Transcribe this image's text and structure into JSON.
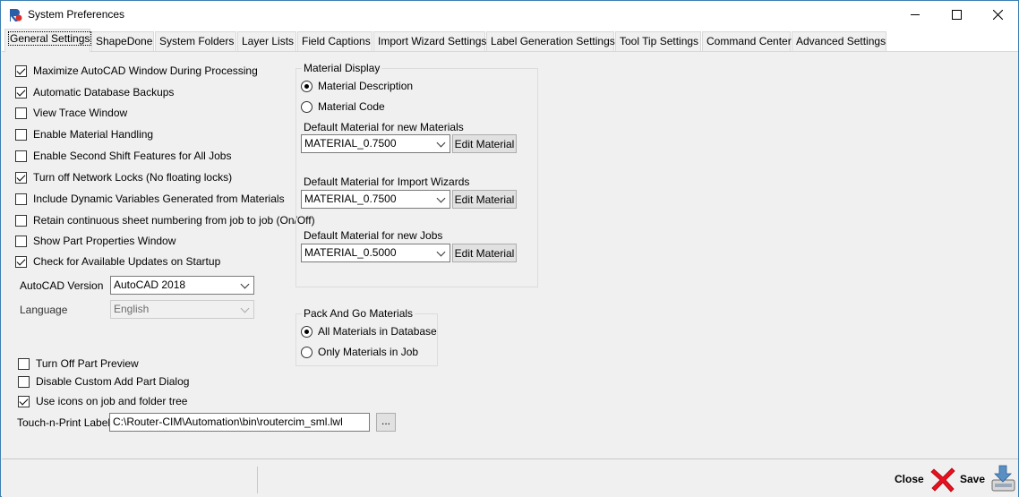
{
  "window": {
    "title": "System Preferences",
    "icon": "app-logo-icon",
    "controls": [
      "minimize-icon",
      "maximize-icon",
      "close-icon"
    ]
  },
  "tabs": [
    {
      "label": "General Settings",
      "active": true
    },
    {
      "label": "ShapeDone"
    },
    {
      "label": "System Folders"
    },
    {
      "label": "Layer Lists"
    },
    {
      "label": "Field Captions"
    },
    {
      "label": "Import Wizard Settings"
    },
    {
      "label": "Label Generation Settings"
    },
    {
      "label": "Tool Tip Settings"
    },
    {
      "label": "Command Center"
    },
    {
      "label": "Advanced Settings"
    }
  ],
  "general": {
    "checkboxes": [
      {
        "label": "Maximize AutoCAD Window During Processing",
        "checked": true
      },
      {
        "label": "Automatic Database Backups",
        "checked": true
      },
      {
        "label": "View Trace Window",
        "checked": false
      },
      {
        "label": "Enable Material Handling",
        "checked": false
      },
      {
        "label": "Enable Second Shift Features for All Jobs",
        "checked": false
      },
      {
        "label": "Turn off Network Locks (No floating locks)",
        "checked": true
      },
      {
        "label": "Include Dynamic Variables Generated from Materials",
        "checked": false
      },
      {
        "label": "Retain continuous sheet numbering from job to job (On/Off)",
        "checked": false
      },
      {
        "label": "Show Part Properties Window",
        "checked": false
      },
      {
        "label": "Check for Available Updates on Startup",
        "checked": true
      }
    ],
    "autocad_version": {
      "label": "AutoCAD Version",
      "value": "AutoCAD 2018"
    },
    "language": {
      "label": "Language",
      "value": "English"
    },
    "lower_checkboxes": [
      {
        "label": "Turn Off Part Preview",
        "checked": false
      },
      {
        "label": "Disable Custom Add Part Dialog",
        "checked": false
      },
      {
        "label": "Use icons on job and folder tree",
        "checked": true
      }
    ],
    "touch_label": {
      "label": "Touch-n-Print Label",
      "value": "C:\\Router-CIM\\Automation\\bin\\routercim_sml.lwl",
      "browse": "..."
    }
  },
  "material_display": {
    "title": "Material Display",
    "radios": [
      {
        "label": "Material Description",
        "selected": true
      },
      {
        "label": "Material Code",
        "selected": false
      }
    ],
    "defaults": [
      {
        "label": "Default Material for new Materials",
        "value": "MATERIAL_0.7500",
        "button": "Edit Material"
      },
      {
        "label": "Default Material for Import Wizards",
        "value": "MATERIAL_0.7500",
        "button": "Edit Material"
      },
      {
        "label": "Default Material for new Jobs",
        "value": "MATERIAL_0.5000",
        "button": "Edit Material"
      }
    ]
  },
  "pack_and_go": {
    "title": "Pack And Go Materials",
    "radios": [
      {
        "label": "All Materials in Database",
        "selected": true
      },
      {
        "label": "Only Materials in Job",
        "selected": false
      }
    ]
  },
  "footer": {
    "close_label": "Close",
    "save_label": "Save"
  },
  "colors": {
    "close_x": "#e81123",
    "save_icon": "#5a8fc4"
  }
}
